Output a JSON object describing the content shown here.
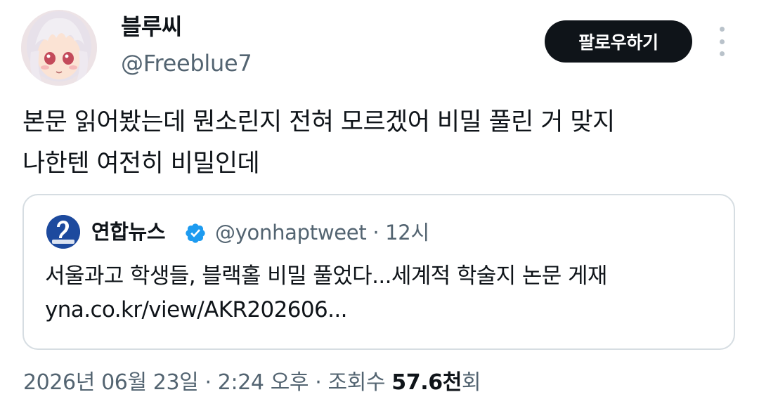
{
  "author": {
    "display_name": "블루씨",
    "handle": "@Freeblue7",
    "avatar": "anime-character-avatar"
  },
  "actions": {
    "follow_label": "팔로우하기",
    "more_icon": "more-vertical-icon"
  },
  "tweet": {
    "lines": [
      "본문 읽어봤는데 뭔소린지 전혀 모르겠어 비밀 풀린 거 맞지",
      "나한텐 여전히 비밀인데"
    ]
  },
  "quote": {
    "display_name": "연합뉴스",
    "verified_icon": "verified-badge-icon",
    "avatar": "yonhap-news-logo",
    "handle": "@yonhaptweet",
    "separator": "·",
    "time": "12시",
    "lines": [
      "서울과고 학생들, 블랙홀 비밀 풀었다...세계적 학술지 논문 게재",
      "yna.co.kr/view/AKR202606..."
    ]
  },
  "footer": {
    "date": "2026년 06월 23일",
    "sep1": "·",
    "time": "2:24 오후",
    "sep2": "·",
    "views_label": "조회수",
    "views_count": "57.6천",
    "views_suffix": "회"
  },
  "colors": {
    "text_primary": "#0f1419",
    "text_secondary": "#536471",
    "follow_bg": "#0f1419",
    "border": "#d6dde2",
    "verified": "#1d9bf0"
  }
}
